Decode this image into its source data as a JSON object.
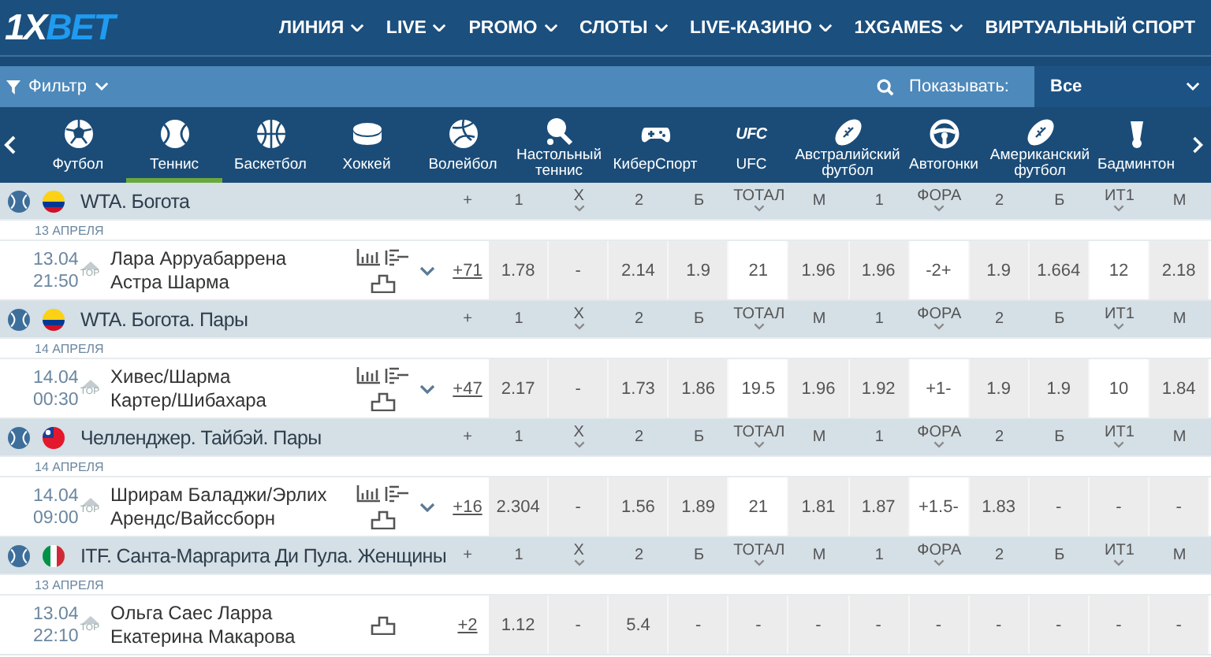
{
  "header": {
    "logo": {
      "lead": "1X",
      "tail": "BET"
    },
    "nav": [
      {
        "label": "ЛИНИЯ",
        "dropdown": true
      },
      {
        "label": "LIVE",
        "dropdown": true
      },
      {
        "label": "PROMO",
        "dropdown": true
      },
      {
        "label": "СЛОТЫ",
        "dropdown": true
      },
      {
        "label": "LIVE-КАЗИНО",
        "dropdown": true
      },
      {
        "label": "1XGAMES",
        "dropdown": true
      },
      {
        "label": "ВИРТУАЛЬНЫЙ СПОРТ",
        "dropdown": false
      }
    ]
  },
  "filter_bar": {
    "filter_label": "Фильтр",
    "show_label": "Показывать:",
    "show_value": "Все"
  },
  "sports": [
    {
      "kind": "soccer",
      "label": "Футбол",
      "selected": false
    },
    {
      "kind": "tennis",
      "label": "Теннис",
      "selected": true
    },
    {
      "kind": "basketball",
      "label": "Баскетбол",
      "selected": false
    },
    {
      "kind": "hockey",
      "label": "Хоккей",
      "selected": false
    },
    {
      "kind": "volleyball",
      "label": "Волейбол",
      "selected": false
    },
    {
      "kind": "tabletennis",
      "label": "Настольный теннис",
      "selected": false
    },
    {
      "kind": "esports",
      "label": "КиберСпорт",
      "selected": false
    },
    {
      "kind": "logo",
      "logo": "UFC",
      "label": "UFC",
      "selected": false
    },
    {
      "kind": "rugby",
      "label": "Австралийский футбол",
      "selected": false
    },
    {
      "kind": "racing",
      "label": "Автогонки",
      "selected": false
    },
    {
      "kind": "rugby",
      "label": "Американский футбол",
      "selected": false
    },
    {
      "kind": "badminton",
      "label": "Бадминтон",
      "selected": false
    }
  ],
  "leagues": [
    {
      "flag": {
        "kind": "colombia"
      },
      "name": "WTA. Богота",
      "columns": [
        {
          "label": "+",
          "dropdown": false
        },
        {
          "label": "1",
          "dropdown": false
        },
        {
          "label": "X",
          "dropdown": true
        },
        {
          "label": "2",
          "dropdown": false
        },
        {
          "label": "Б",
          "dropdown": false
        },
        {
          "label": "ТОТАЛ",
          "dropdown": true
        },
        {
          "label": "М",
          "dropdown": false
        },
        {
          "label": "1",
          "dropdown": false
        },
        {
          "label": "ФОРА",
          "dropdown": true
        },
        {
          "label": "2",
          "dropdown": false
        },
        {
          "label": "Б",
          "dropdown": false
        },
        {
          "label": "ИТ1",
          "dropdown": true
        },
        {
          "label": "М",
          "dropdown": false
        }
      ],
      "date": "13 АПРЕЛЯ",
      "match": {
        "date": "13.04",
        "time": "21:50",
        "top": "TOP",
        "players": [
          "Лара Арруабаррена",
          "Астра Шарма"
        ],
        "stats": true,
        "expandable": true,
        "more": "+71",
        "cells": [
          {
            "value": "1.78",
            "kind": "odd"
          },
          {
            "value": "-",
            "kind": "odd"
          },
          {
            "value": "2.14",
            "kind": "odd"
          },
          {
            "value": "1.9",
            "kind": "odd"
          },
          {
            "value": "21",
            "kind": "param"
          },
          {
            "value": "1.96",
            "kind": "odd"
          },
          {
            "value": "1.96",
            "kind": "odd"
          },
          {
            "value": "-2+",
            "kind": "param"
          },
          {
            "value": "1.9",
            "kind": "odd"
          },
          {
            "value": "1.664",
            "kind": "odd"
          },
          {
            "value": "12",
            "kind": "param"
          },
          {
            "value": "2.18",
            "kind": "odd"
          }
        ]
      }
    },
    {
      "flag": {
        "kind": "colombia"
      },
      "name": "WTA. Богота. Пары",
      "columns": [
        {
          "label": "+",
          "dropdown": false
        },
        {
          "label": "1",
          "dropdown": false
        },
        {
          "label": "X",
          "dropdown": true
        },
        {
          "label": "2",
          "dropdown": false
        },
        {
          "label": "Б",
          "dropdown": false
        },
        {
          "label": "ТОТАЛ",
          "dropdown": true
        },
        {
          "label": "М",
          "dropdown": false
        },
        {
          "label": "1",
          "dropdown": false
        },
        {
          "label": "ФОРА",
          "dropdown": true
        },
        {
          "label": "2",
          "dropdown": false
        },
        {
          "label": "Б",
          "dropdown": false
        },
        {
          "label": "ИТ1",
          "dropdown": true
        },
        {
          "label": "М",
          "dropdown": false
        }
      ],
      "date": "14 АПРЕЛЯ",
      "match": {
        "date": "14.04",
        "time": "00:30",
        "top": "TOP",
        "players": [
          "Хивес/Шарма",
          "Картер/Шибахара"
        ],
        "stats": true,
        "expandable": true,
        "more": "+47",
        "cells": [
          {
            "value": "2.17",
            "kind": "odd"
          },
          {
            "value": "-",
            "kind": "odd"
          },
          {
            "value": "1.73",
            "kind": "odd"
          },
          {
            "value": "1.86",
            "kind": "odd"
          },
          {
            "value": "19.5",
            "kind": "param"
          },
          {
            "value": "1.96",
            "kind": "odd"
          },
          {
            "value": "1.92",
            "kind": "odd"
          },
          {
            "value": "+1-",
            "kind": "param"
          },
          {
            "value": "1.9",
            "kind": "odd"
          },
          {
            "value": "1.9",
            "kind": "odd"
          },
          {
            "value": "10",
            "kind": "param"
          },
          {
            "value": "1.84",
            "kind": "odd"
          }
        ]
      }
    },
    {
      "flag": {
        "kind": "taiwan"
      },
      "name": "Челленджер. Тайбэй. Пары",
      "columns": [
        {
          "label": "+",
          "dropdown": false
        },
        {
          "label": "1",
          "dropdown": false
        },
        {
          "label": "X",
          "dropdown": true
        },
        {
          "label": "2",
          "dropdown": false
        },
        {
          "label": "Б",
          "dropdown": false
        },
        {
          "label": "ТОТАЛ",
          "dropdown": true
        },
        {
          "label": "М",
          "dropdown": false
        },
        {
          "label": "1",
          "dropdown": false
        },
        {
          "label": "ФОРА",
          "dropdown": true
        },
        {
          "label": "2",
          "dropdown": false
        },
        {
          "label": "Б",
          "dropdown": false
        },
        {
          "label": "ИТ1",
          "dropdown": true
        },
        {
          "label": "М",
          "dropdown": false
        }
      ],
      "date": "14 АПРЕЛЯ",
      "match": {
        "date": "14.04",
        "time": "09:00",
        "top": "TOP",
        "players": [
          "Шрирам Баладжи/Эрлих",
          "Арендс/Вайссборн"
        ],
        "stats": true,
        "expandable": true,
        "more": "+16",
        "cells": [
          {
            "value": "2.304",
            "kind": "odd"
          },
          {
            "value": "-",
            "kind": "odd"
          },
          {
            "value": "1.56",
            "kind": "odd"
          },
          {
            "value": "1.89",
            "kind": "odd"
          },
          {
            "value": "21",
            "kind": "param"
          },
          {
            "value": "1.81",
            "kind": "odd"
          },
          {
            "value": "1.87",
            "kind": "odd"
          },
          {
            "value": "+1.5-",
            "kind": "param"
          },
          {
            "value": "1.83",
            "kind": "odd"
          },
          {
            "value": "-",
            "kind": "odd"
          },
          {
            "value": "-",
            "kind": "odd"
          },
          {
            "value": "-",
            "kind": "odd"
          }
        ]
      }
    },
    {
      "flag": {
        "kind": "italy"
      },
      "name": "ITF. Санта-Маргарита Ди Пула. Женщины",
      "columns": [
        {
          "label": "+",
          "dropdown": false
        },
        {
          "label": "1",
          "dropdown": false
        },
        {
          "label": "X",
          "dropdown": true
        },
        {
          "label": "2",
          "dropdown": false
        },
        {
          "label": "Б",
          "dropdown": false
        },
        {
          "label": "ТОТАЛ",
          "dropdown": true
        },
        {
          "label": "М",
          "dropdown": false
        },
        {
          "label": "1",
          "dropdown": false
        },
        {
          "label": "ФОРА",
          "dropdown": true
        },
        {
          "label": "2",
          "dropdown": false
        },
        {
          "label": "Б",
          "dropdown": false
        },
        {
          "label": "ИТ1",
          "dropdown": true
        },
        {
          "label": "М",
          "dropdown": false
        }
      ],
      "date": "13 АПРЕЛЯ",
      "match": {
        "date": "13.04",
        "time": "22:10",
        "top": "TOP",
        "players": [
          "Ольга Саес Ларра",
          "Екатерина Макарова"
        ],
        "stats": false,
        "expandable": false,
        "more": "+2",
        "cells": [
          {
            "value": "1.12",
            "kind": "odd"
          },
          {
            "value": "-",
            "kind": "odd"
          },
          {
            "value": "5.4",
            "kind": "odd"
          },
          {
            "value": "-",
            "kind": "odd"
          },
          {
            "value": "-",
            "kind": "odd"
          },
          {
            "value": "-",
            "kind": "odd"
          },
          {
            "value": "-",
            "kind": "odd"
          },
          {
            "value": "-",
            "kind": "odd"
          },
          {
            "value": "-",
            "kind": "odd"
          },
          {
            "value": "-",
            "kind": "odd"
          },
          {
            "value": "-",
            "kind": "odd"
          },
          {
            "value": "-",
            "kind": "odd"
          }
        ]
      }
    }
  ]
}
